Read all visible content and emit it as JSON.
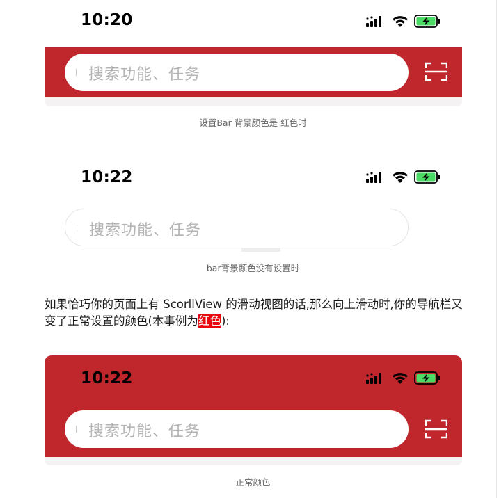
{
  "shots": [
    {
      "time": "10:20",
      "search_placeholder": "搜索功能、任务",
      "caption": "设置Bar 背景颜色是 红色时",
      "bar_color": "#c0272d"
    },
    {
      "time": "10:22",
      "search_placeholder": "搜索功能、任务",
      "caption": "bar背景颜色没有设置时"
    },
    {
      "time": "10:22",
      "search_placeholder": "搜索功能、任务",
      "caption": "正常颜色",
      "bar_color": "#c0272d"
    }
  ],
  "paragraph": {
    "line1": "如果恰巧你的页面上有 ScorllView 的滑动视图的话,那么向上滑动时,你的导航栏又",
    "line2_before": "变了正常设置的颜色(本事例为",
    "highlight": "红色",
    "line2_after": "):"
  },
  "icons": {
    "signal": "cellular-signal-icon",
    "wifi": "wifi-icon",
    "battery": "battery-charging-icon",
    "scan": "scan-icon"
  },
  "colors": {
    "brand_red": "#c0272d",
    "highlight_red": "#e8080e",
    "battery_green": "#4cd964"
  }
}
